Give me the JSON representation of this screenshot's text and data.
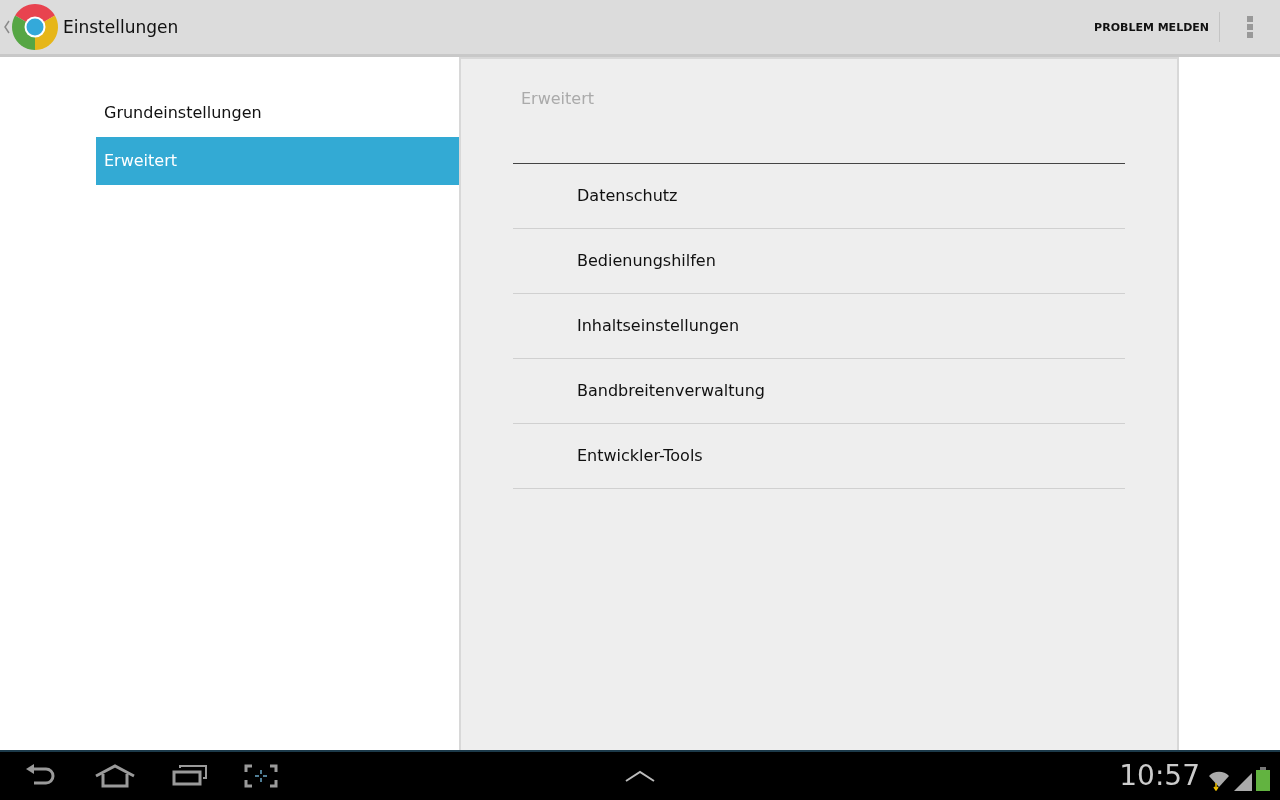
{
  "action_bar": {
    "title": "Einstellungen",
    "action": "PROBLEM MELDEN"
  },
  "nav": [
    {
      "label": "Grundeinstellungen",
      "selected": false
    },
    {
      "label": "Erweitert",
      "selected": true
    }
  ],
  "panel": {
    "heading": "Erweitert",
    "items": [
      "Datenschutz",
      "Bedienungshilfen",
      "Inhaltseinstellungen",
      "Bandbreitenverwaltung",
      "Entwickler-Tools"
    ]
  },
  "system_bar": {
    "time": "10:57"
  }
}
